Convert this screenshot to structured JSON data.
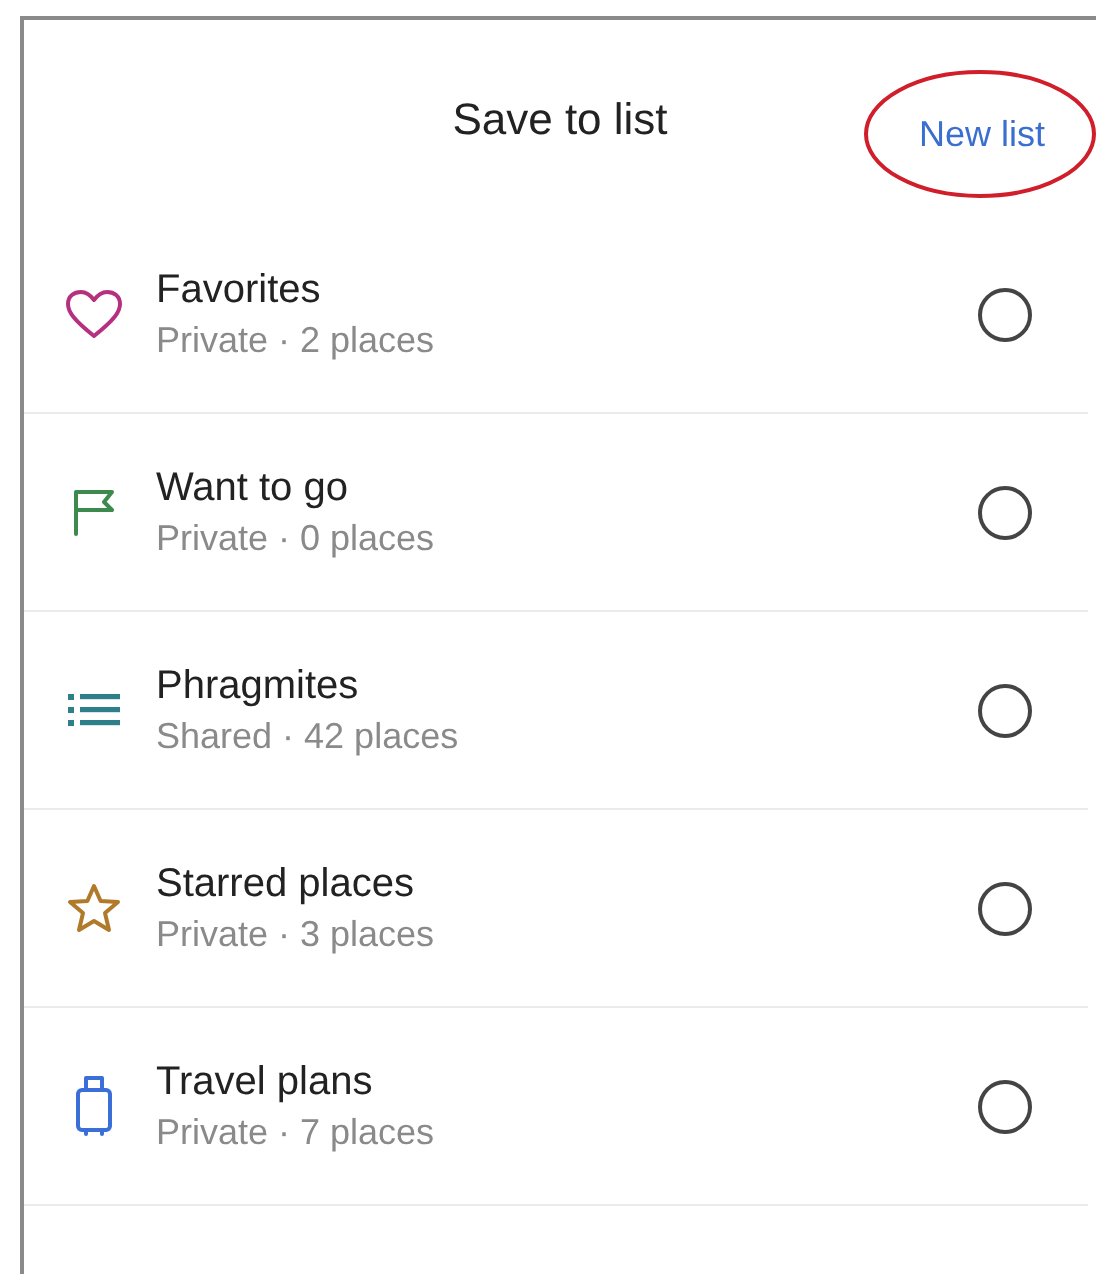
{
  "title": "Save to list",
  "new_list": {
    "label": "New list",
    "circled": true
  },
  "lists": [
    {
      "kind": "heart",
      "color": "#b5307f",
      "name": "Favorites",
      "detail": "Private · 2 places",
      "selected": false
    },
    {
      "kind": "flag",
      "color": "#3d8a4e",
      "name": "Want to go",
      "detail": "Private · 0 places",
      "selected": false
    },
    {
      "kind": "list",
      "color": "#2f7f8a",
      "name": "Phragmites",
      "detail": "Shared · 42 places",
      "selected": false
    },
    {
      "kind": "star",
      "color": "#b07a2a",
      "name": "Starred places",
      "detail": "Private · 3 places",
      "selected": false
    },
    {
      "kind": "luggage",
      "color": "#3a6fd8",
      "name": "Travel plans",
      "detail": "Private · 7 places",
      "selected": false
    }
  ]
}
